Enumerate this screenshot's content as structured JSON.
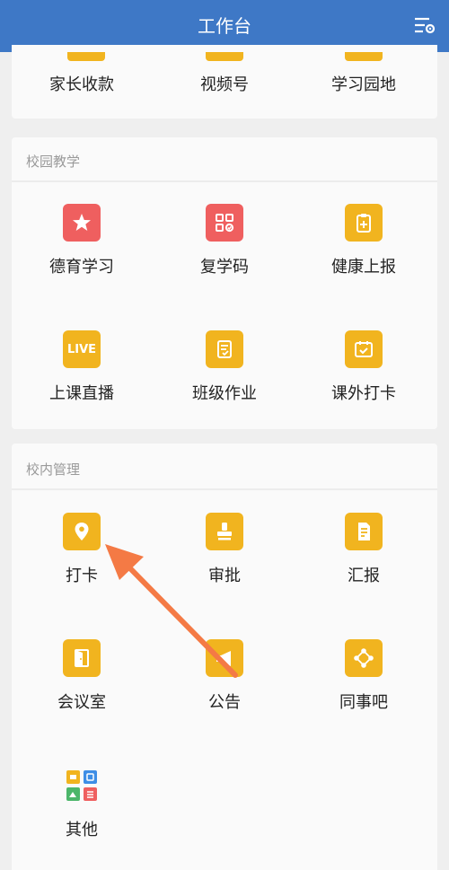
{
  "header": {
    "title": "工作台"
  },
  "top_row": [
    "家长收款",
    "视频号",
    "学习园地"
  ],
  "campus_teaching": {
    "title": "校园教学",
    "items": [
      "德育学习",
      "复学码",
      "健康上报",
      "上课直播",
      "班级作业",
      "课外打卡"
    ],
    "live_icon_text": "LIVE"
  },
  "campus_management": {
    "title": "校内管理",
    "items": [
      "打卡",
      "审批",
      "汇报",
      "会议室",
      "公告",
      "同事吧",
      "其他"
    ]
  },
  "colors": {
    "header": "#3e78c6",
    "icon_red": "#ef5f5f",
    "icon_yellow": "#f1b41f",
    "arrow": "#f47a45"
  }
}
